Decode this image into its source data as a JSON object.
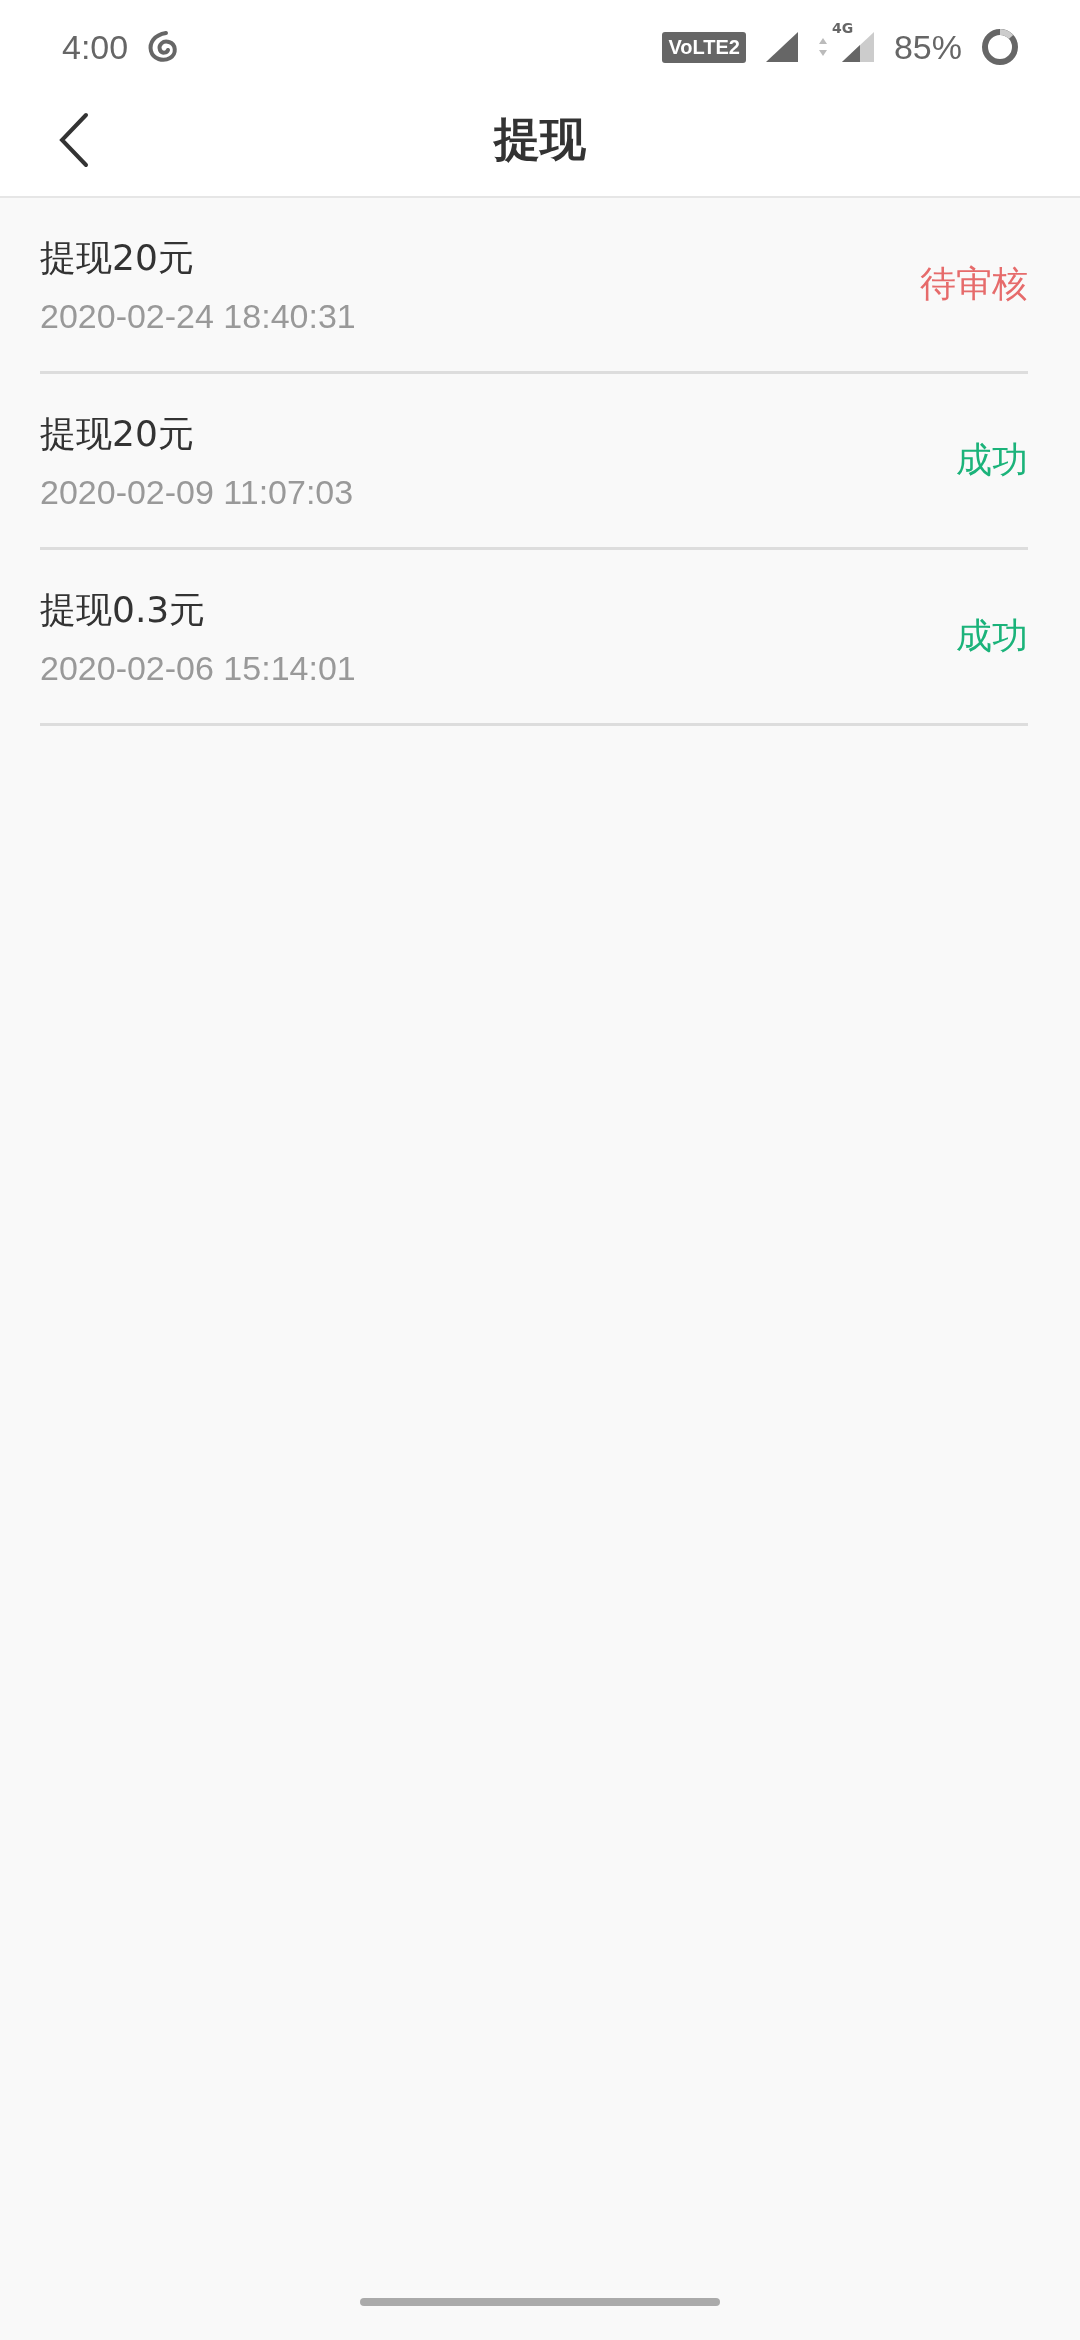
{
  "status_bar": {
    "time": "4:00",
    "volte": "VoLTE2",
    "network": "4G",
    "battery": "85%"
  },
  "header": {
    "title": "提现"
  },
  "records": [
    {
      "title": "提现20元",
      "time": "2020-02-24 18:40:31",
      "status": "待审核",
      "color": "#e66b6b"
    },
    {
      "title": "提现20元",
      "time": "2020-02-09 11:07:03",
      "status": "成功",
      "color": "#1bb37a"
    },
    {
      "title": "提现0.3元",
      "time": "2020-02-06 15:14:01",
      "status": "成功",
      "color": "#1bb37a"
    }
  ]
}
